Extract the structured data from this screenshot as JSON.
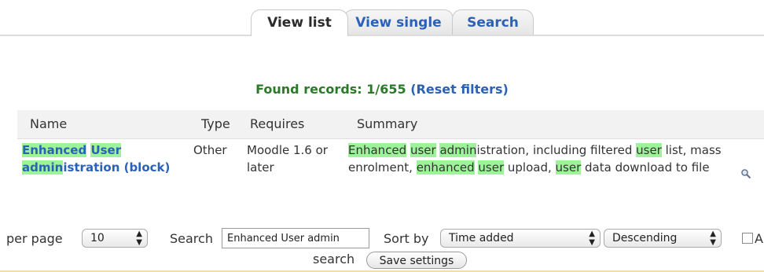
{
  "tabs": [
    {
      "label": "View list",
      "active": true
    },
    {
      "label": "View single",
      "active": false
    },
    {
      "label": "Search",
      "active": false
    }
  ],
  "found": {
    "prefix": "Found records: 1/655",
    "reset_link": "(Reset filters)"
  },
  "table": {
    "columns": [
      "Name",
      "Type",
      "Requires",
      "Summary"
    ],
    "rows": [
      {
        "name_parts": [
          "Enhanced",
          " ",
          "User",
          " ",
          "admin",
          "istration (block)"
        ],
        "type": "Other",
        "requires": "Moodle 1.6 or later",
        "summary_parts": [
          "Enhanced",
          " ",
          "user",
          " ",
          "admin",
          "istration, including filtered ",
          "user",
          " list, mass enrolment, ",
          "enhanced",
          " ",
          "user",
          " upload, ",
          "user",
          " data download to file"
        ]
      }
    ]
  },
  "controls": {
    "per_page_label": "per page",
    "per_page_value": "10",
    "search_label": "Search",
    "search_value": "Enhanced User admin",
    "sort_by_label": "Sort by",
    "sort_field_value": "Time added",
    "sort_order_value": "Descending",
    "advanced_label_partial": "A",
    "search_suffix": "search",
    "save_button": "Save settings"
  },
  "colors": {
    "highlight": "#9ef29a",
    "link": "#2b62b8",
    "found_text": "#2a7a2a"
  },
  "icons": {
    "row_view": "magnifier-icon"
  }
}
